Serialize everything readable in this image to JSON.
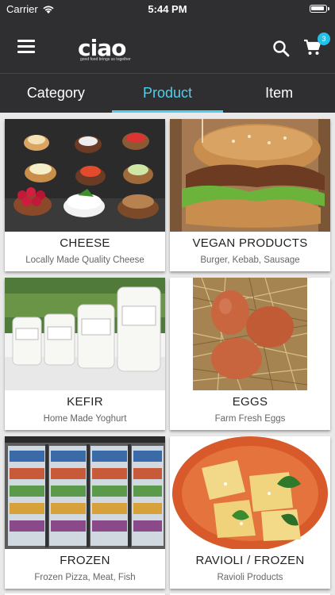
{
  "status_bar": {
    "carrier": "Carrier",
    "time": "5:44 PM"
  },
  "header": {
    "logo_text": "ciao",
    "logo_tagline": "good food brings us together",
    "cart_count": "3"
  },
  "tabs": [
    {
      "label": "Category",
      "active": false
    },
    {
      "label": "Product",
      "active": true
    },
    {
      "label": "Item",
      "active": false
    }
  ],
  "products": [
    {
      "title": "CHEESE",
      "subtitle": "Locally Made Quality Cheese"
    },
    {
      "title": "VEGAN PRODUCTS",
      "subtitle": "Burger, Kebab, Sausage"
    },
    {
      "title": "KEFIR",
      "subtitle": "Home Made Yoghurt"
    },
    {
      "title": "EGGS",
      "subtitle": "Farm Fresh Eggs"
    },
    {
      "title": "FROZEN",
      "subtitle": "Frozen Pizza, Meat, Fish"
    },
    {
      "title": "RAVIOLI / FROZEN",
      "subtitle": "Ravioli Products"
    }
  ],
  "colors": {
    "header_bg": "#2f2f31",
    "accent": "#4fd0ea",
    "badge": "#23c1e8"
  }
}
